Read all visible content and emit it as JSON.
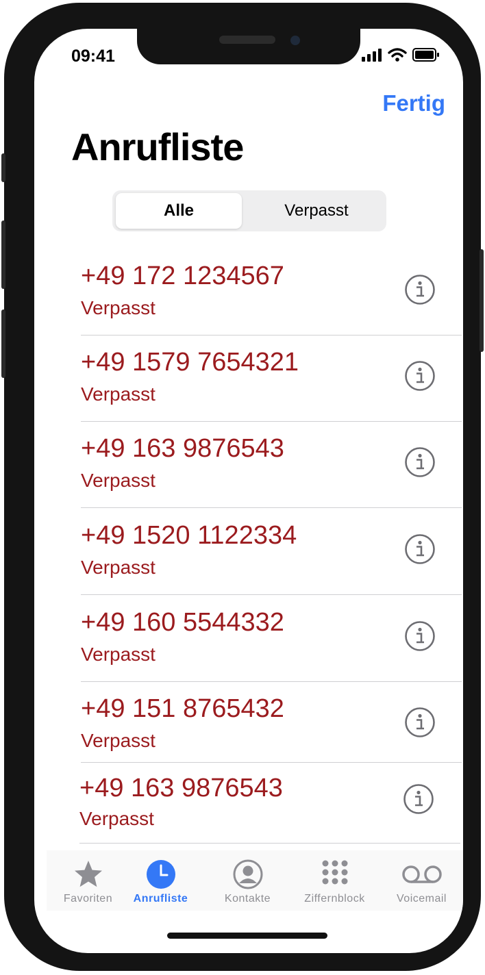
{
  "status_bar": {
    "time": "09:41"
  },
  "header": {
    "done_label": "Fertig",
    "title": "Anrufliste"
  },
  "segmented_control": {
    "options": [
      "Alle",
      "Verpasst"
    ],
    "selected": "Alle"
  },
  "calls": [
    {
      "number": "+49 172 1234567",
      "status": "Verpasst"
    },
    {
      "number": "+49 1579 7654321",
      "status": "Verpasst"
    },
    {
      "number": "+49 163 9876543",
      "status": "Verpasst"
    },
    {
      "number": "+49 1520 1122334",
      "status": "Verpasst"
    },
    {
      "number": "+49 160 5544332",
      "status": "Verpasst"
    },
    {
      "number": "+49 151 8765432",
      "status": "Verpasst"
    },
    {
      "number": "+49 163 9876543",
      "status": "Verpasst"
    }
  ],
  "tab_bar": {
    "tabs": [
      {
        "label": "Favoriten",
        "icon": "star-icon"
      },
      {
        "label": "Anrufliste",
        "icon": "clock-icon"
      },
      {
        "label": "Kontakte",
        "icon": "person-circle-icon"
      },
      {
        "label": "Ziffernblock",
        "icon": "keypad-icon"
      },
      {
        "label": "Voicemail",
        "icon": "voicemail-icon"
      }
    ],
    "active": "Anrufliste"
  },
  "colors": {
    "accent": "#3478f6",
    "missed": "#9b1b1e",
    "inactive": "#8e8e93"
  }
}
